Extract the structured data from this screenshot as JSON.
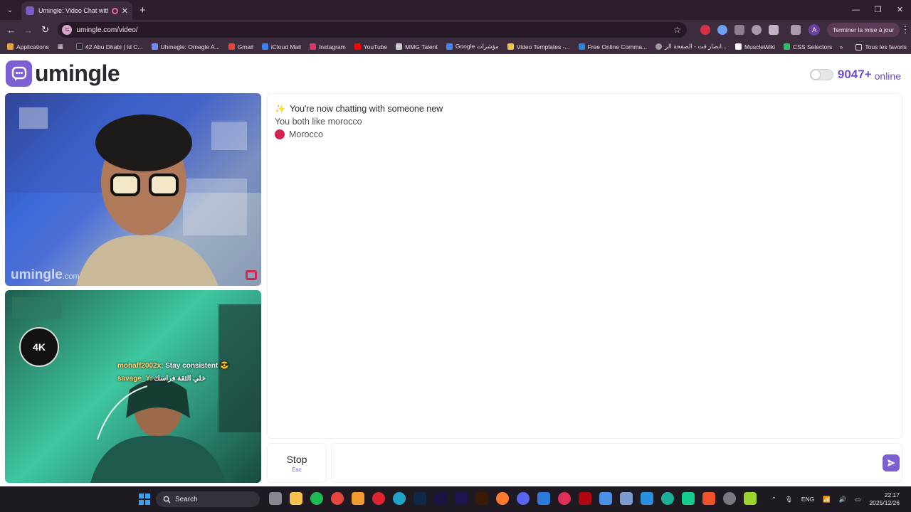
{
  "browser": {
    "tab_title": "Umingle: Video Chat with S",
    "url": "umingle.com/video/",
    "update_button": "Terminer la mise à jour",
    "profile_initial": "A"
  },
  "bookmarks": {
    "items": [
      {
        "label": "Applications",
        "color": "#e8a33a"
      },
      {
        "label": "42 Abu Dhabi | Id C...",
        "color": "#2b2b2b"
      },
      {
        "label": "Uhmegle: Omegle A...",
        "color": "#6b8cff"
      },
      {
        "label": "Gmail",
        "color": "#ea4335"
      },
      {
        "label": "iCloud Mail",
        "color": "#3b82f6"
      },
      {
        "label": "Instagram",
        "color": "#e1306c"
      },
      {
        "label": "YouTube",
        "color": "#ff0000"
      },
      {
        "label": "MMG Talent",
        "color": "#cccccc"
      },
      {
        "label": "Google مؤشرات",
        "color": "#4285f4"
      },
      {
        "label": "Video Templates -...",
        "color": "#f5c542"
      },
      {
        "label": "Free Online Comma...",
        "color": "#1e88e5"
      },
      {
        "label": "انصار فت - الصفحة الر...",
        "color": "#9e9e9e"
      },
      {
        "label": "MuscleWiki",
        "color": "#ffffff"
      },
      {
        "label": "CSS Selectors",
        "color": "#22c55e"
      }
    ],
    "all_favorites": "Tous les favoris"
  },
  "header": {
    "logo_text": "umingle",
    "online_count": "9047+",
    "online_label": "online"
  },
  "videos": {
    "watermark": "umingle",
    "watermark_suffix": ".com",
    "badge_text": "4K",
    "stream_chat": [
      {
        "user": "mohaff2002x",
        "message": ": Stay consistent 😎"
      },
      {
        "user": "savage_Y",
        "message": ": خلي الثقة فراسك"
      }
    ]
  },
  "chat": {
    "status": "You're now chatting with someone new",
    "common_interest": "You both like morocco",
    "country": "Morocco",
    "accent": "#7c5fd3",
    "country_color": "#d3254f"
  },
  "controls": {
    "stop_label": "Stop",
    "stop_key": "Esc",
    "input_placeholder": ""
  },
  "taskbar": {
    "search_label": "Search",
    "language": "ENG",
    "time": "22:17",
    "date": "2025/12/26"
  }
}
